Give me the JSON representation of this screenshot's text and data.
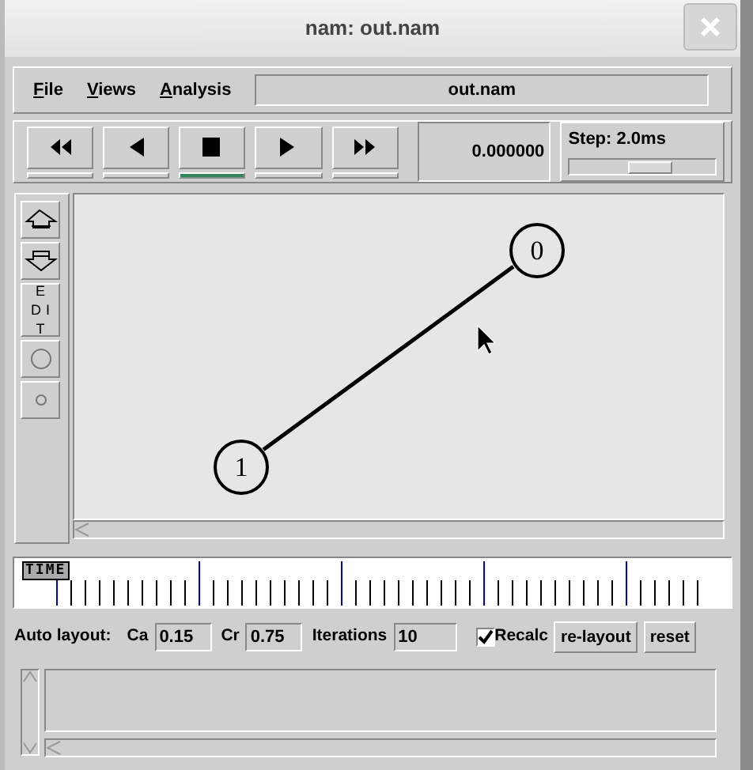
{
  "window": {
    "title": "nam: out.nam"
  },
  "menu": [
    {
      "label": "File"
    },
    {
      "label": "Views"
    },
    {
      "label": "Analysis"
    }
  ],
  "file_field": "out.nam",
  "controls": [
    {
      "kind": "rewind",
      "selected": false
    },
    {
      "kind": "back",
      "selected": false
    },
    {
      "kind": "stop",
      "selected": true
    },
    {
      "kind": "play",
      "selected": false
    },
    {
      "kind": "forward",
      "selected": false
    }
  ],
  "time": "0.000000",
  "step": {
    "label": "Step: 2.0ms",
    "level": 0.55
  },
  "tools": [
    {
      "kind": "zoom-in"
    },
    {
      "kind": "zoom-out"
    },
    {
      "kind": "edit",
      "label": "EDIT"
    },
    {
      "kind": "big-circle"
    },
    {
      "kind": "small-circle"
    }
  ],
  "network": {
    "nodes": [
      {
        "label": "0"
      },
      {
        "label": "1"
      }
    ]
  },
  "timeline": {
    "label": "TIME"
  },
  "auto_layout": {
    "label": "Auto layout:",
    "fields": [
      {
        "label": "Ca",
        "value": "0.15"
      },
      {
        "label": "Cr",
        "value": "0.75"
      },
      {
        "label": "Iterations",
        "value": "10"
      }
    ],
    "recalc": {
      "label": "Recalc",
      "checked": true
    },
    "buttons": [
      "re-layout",
      "reset"
    ]
  }
}
